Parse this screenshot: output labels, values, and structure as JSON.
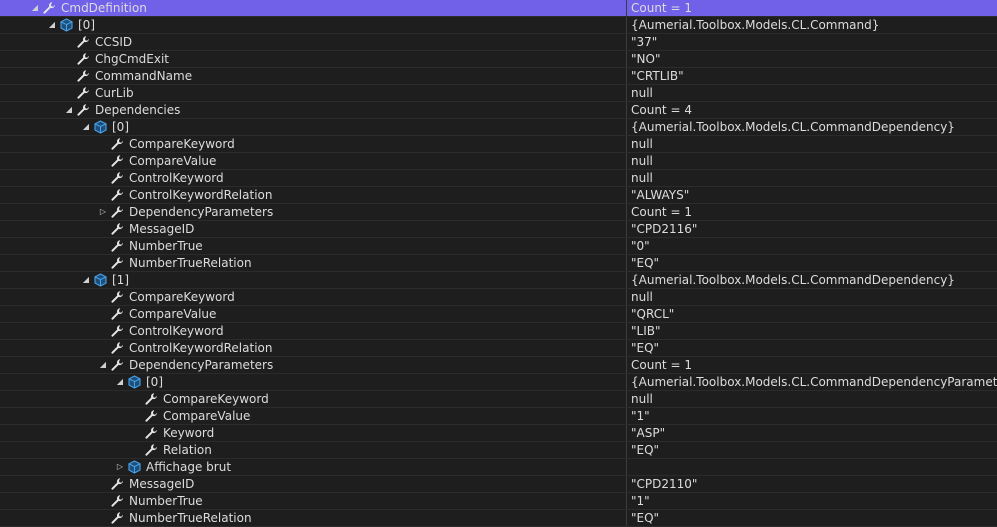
{
  "icons": {
    "property": "wrench-icon",
    "object": "cube-icon",
    "expanded": "triangle-down-icon",
    "collapsed": "triangle-right-icon"
  },
  "colors": {
    "selection": "#7160e8",
    "background": "#1e1e1e",
    "text": "#dcdcdc",
    "cube": "#3f8fd6"
  },
  "rows": [
    {
      "name": "CmdDefinition",
      "value": "Count = 1",
      "depth": 0,
      "icon": "property",
      "expander": "expanded",
      "selected": true
    },
    {
      "name": "[0]",
      "value": "{Aumerial.Toolbox.Models.CL.Command}",
      "depth": 1,
      "icon": "object",
      "expander": "expanded"
    },
    {
      "name": "CCSID",
      "value": "\"37\"",
      "depth": 2,
      "icon": "property",
      "expander": "none"
    },
    {
      "name": "ChgCmdExit",
      "value": "\"NO\"",
      "depth": 2,
      "icon": "property",
      "expander": "none"
    },
    {
      "name": "CommandName",
      "value": "\"CRTLIB\"",
      "depth": 2,
      "icon": "property",
      "expander": "none"
    },
    {
      "name": "CurLib",
      "value": "null",
      "depth": 2,
      "icon": "property",
      "expander": "none"
    },
    {
      "name": "Dependencies",
      "value": "Count = 4",
      "depth": 2,
      "icon": "property",
      "expander": "expanded"
    },
    {
      "name": "[0]",
      "value": "{Aumerial.Toolbox.Models.CL.CommandDependency}",
      "depth": 3,
      "icon": "object",
      "expander": "expanded"
    },
    {
      "name": "CompareKeyword",
      "value": "null",
      "depth": 4,
      "icon": "property",
      "expander": "none"
    },
    {
      "name": "CompareValue",
      "value": "null",
      "depth": 4,
      "icon": "property",
      "expander": "none"
    },
    {
      "name": "ControlKeyword",
      "value": "null",
      "depth": 4,
      "icon": "property",
      "expander": "none"
    },
    {
      "name": "ControlKeywordRelation",
      "value": "\"ALWAYS\"",
      "depth": 4,
      "icon": "property",
      "expander": "none"
    },
    {
      "name": "DependencyParameters",
      "value": "Count = 1",
      "depth": 4,
      "icon": "property",
      "expander": "collapsed"
    },
    {
      "name": "MessageID",
      "value": "\"CPD2116\"",
      "depth": 4,
      "icon": "property",
      "expander": "none"
    },
    {
      "name": "NumberTrue",
      "value": "\"0\"",
      "depth": 4,
      "icon": "property",
      "expander": "none"
    },
    {
      "name": "NumberTrueRelation",
      "value": "\"EQ\"",
      "depth": 4,
      "icon": "property",
      "expander": "none"
    },
    {
      "name": "[1]",
      "value": "{Aumerial.Toolbox.Models.CL.CommandDependency}",
      "depth": 3,
      "icon": "object",
      "expander": "expanded"
    },
    {
      "name": "CompareKeyword",
      "value": "null",
      "depth": 4,
      "icon": "property",
      "expander": "none"
    },
    {
      "name": "CompareValue",
      "value": "\"QRCL\"",
      "depth": 4,
      "icon": "property",
      "expander": "none"
    },
    {
      "name": "ControlKeyword",
      "value": "\"LIB\"",
      "depth": 4,
      "icon": "property",
      "expander": "none"
    },
    {
      "name": "ControlKeywordRelation",
      "value": "\"EQ\"",
      "depth": 4,
      "icon": "property",
      "expander": "none"
    },
    {
      "name": "DependencyParameters",
      "value": "Count = 1",
      "depth": 4,
      "icon": "property",
      "expander": "expanded"
    },
    {
      "name": "[0]",
      "value": "{Aumerial.Toolbox.Models.CL.CommandDependencyParameter}",
      "depth": 5,
      "icon": "object",
      "expander": "expanded"
    },
    {
      "name": "CompareKeyword",
      "value": "null",
      "depth": 6,
      "icon": "property",
      "expander": "none"
    },
    {
      "name": "CompareValue",
      "value": "\"1\"",
      "depth": 6,
      "icon": "property",
      "expander": "none"
    },
    {
      "name": "Keyword",
      "value": "\"ASP\"",
      "depth": 6,
      "icon": "property",
      "expander": "none"
    },
    {
      "name": "Relation",
      "value": "\"EQ\"",
      "depth": 6,
      "icon": "property",
      "expander": "none"
    },
    {
      "name": "Affichage brut",
      "value": "",
      "depth": 5,
      "icon": "object",
      "expander": "collapsed"
    },
    {
      "name": "MessageID",
      "value": "\"CPD2110\"",
      "depth": 4,
      "icon": "property",
      "expander": "none"
    },
    {
      "name": "NumberTrue",
      "value": "\"1\"",
      "depth": 4,
      "icon": "property",
      "expander": "none"
    },
    {
      "name": "NumberTrueRelation",
      "value": "\"EQ\"",
      "depth": 4,
      "icon": "property",
      "expander": "none"
    }
  ]
}
